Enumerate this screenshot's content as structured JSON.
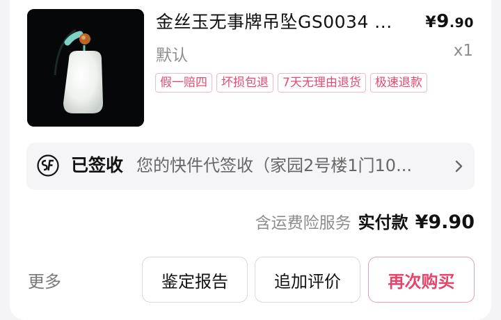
{
  "product": {
    "title": "金丝玉无事牌吊坠GS0034 ...",
    "price_currency": "¥",
    "price_int": "9",
    "price_dec": ".90",
    "spec": "默认",
    "quantity": "x1",
    "tags": [
      "假一赔四",
      "坏损包退",
      "7天无理由退货",
      "极速退款"
    ]
  },
  "logistics": {
    "courier_icon": "sf-express-icon",
    "status": "已签收",
    "description": "您的快件代签收（家园2号楼1门10..."
  },
  "payment": {
    "insurance_note": "含运费险服务",
    "paid_label": "实付款",
    "paid_amount": "¥9.90"
  },
  "actions": {
    "more": "更多",
    "report": "鉴定报告",
    "review": "追加评价",
    "rebuy": "再次购买"
  },
  "colors": {
    "accent": "#e8436b",
    "tag_border": "#f2b9c7",
    "card_bg": "#ffffff",
    "page_bg": "#f4f4f6"
  }
}
